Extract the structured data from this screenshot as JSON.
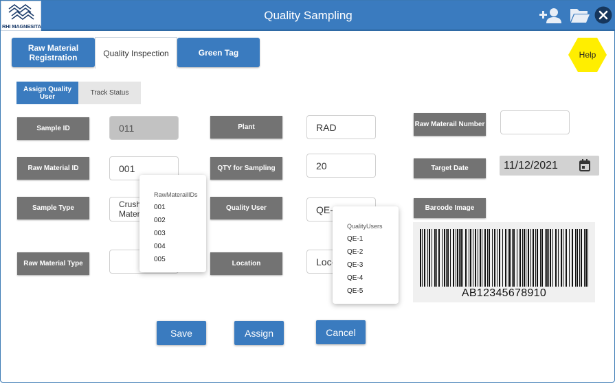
{
  "header": {
    "title": "Quality Sampling",
    "logo_text": "RHI MAGNESITA",
    "icons": [
      "add-user-icon",
      "folder-icon",
      "close-icon"
    ]
  },
  "tabs": [
    {
      "label": "Raw Material Registration",
      "active": false
    },
    {
      "label": "Quality Inspection",
      "active": true
    },
    {
      "label": "Green Tag",
      "active": false
    }
  ],
  "help_label": "Help",
  "subtabs": [
    {
      "label": "Assign Quality User",
      "active": true
    },
    {
      "label": "Track Status",
      "active": false
    }
  ],
  "form": {
    "sample_id_label": "Sample ID",
    "sample_id_value": "011",
    "raw_material_id_label": "Raw Material ID",
    "raw_material_id_value": "001",
    "sample_type_label": "Sample Type",
    "sample_type_value": "Crushed Material",
    "raw_material_type_label": "Raw Material Type",
    "raw_material_type_value": "",
    "plant_label": "Plant",
    "plant_value": "RAD",
    "qty_label": "QTY for Sampling",
    "qty_value": "20",
    "quality_user_label": "Quality User",
    "quality_user_value": "QE-1",
    "location_label": "Location",
    "location_value": "Loc-1",
    "raw_material_number_label": "Raw Materail Number",
    "raw_material_number_value": "",
    "target_date_label": "Target Date",
    "target_date_value": "11/12/2021",
    "barcode_image_label": "Barcode Image",
    "barcode_value": "AB12345678910"
  },
  "raw_material_dropdown": {
    "header": "RawMaterailIDs",
    "options": [
      "001",
      "002",
      "003",
      "004",
      "005"
    ]
  },
  "quality_user_dropdown": {
    "header": "QualityUsers",
    "options": [
      "QE-1",
      "QE-2",
      "QE-3",
      "QE-4",
      "QE-5"
    ]
  },
  "actions": {
    "save_label": "Save",
    "assign_label": "Assign",
    "cancel_label": "Cancel"
  },
  "colors": {
    "primary": "#3a7bbf",
    "label_bg": "#737373",
    "help_bg": "#ffee00"
  }
}
